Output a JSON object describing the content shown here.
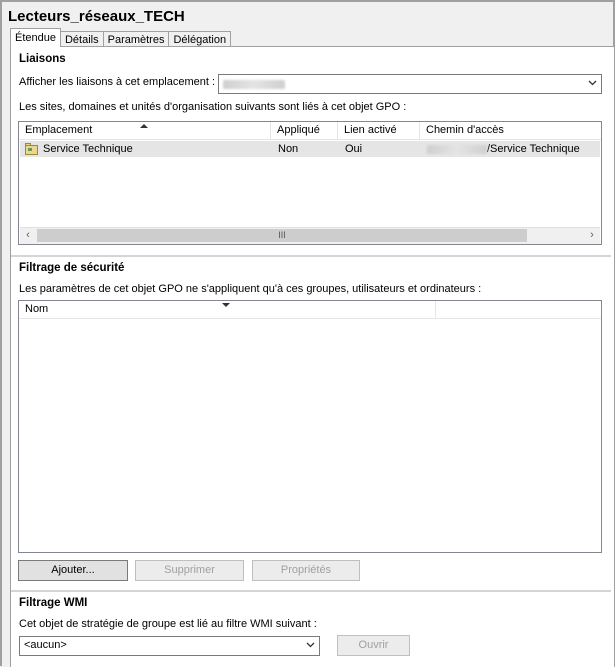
{
  "window": {
    "title": "Lecteurs_réseaux_TECH"
  },
  "tabs": [
    {
      "label": "Étendue",
      "active": true
    },
    {
      "label": "Détails",
      "active": false
    },
    {
      "label": "Paramètres",
      "active": false
    },
    {
      "label": "Délégation",
      "active": false
    }
  ],
  "links": {
    "heading": "Liaisons",
    "location_label": "Afficher les liaisons à cet emplacement :",
    "location_value_redacted": true,
    "description": "Les sites, domaines et unités d'organisation suivants sont liés à cet objet GPO :",
    "columns": [
      "Emplacement",
      "Appliqué",
      "Lien activé",
      "Chemin d'accès"
    ],
    "rows": [
      {
        "location": "Service Technique",
        "applied": "Non",
        "enabled": "Oui",
        "path": "/Service Technique"
      }
    ],
    "scroll_grip": "III"
  },
  "security": {
    "heading": "Filtrage de sécurité",
    "description": "Les paramètres de cet objet GPO ne s'appliquent qu'à ces groupes, utilisateurs et ordinateurs :",
    "columns": [
      "Nom"
    ],
    "buttons": {
      "add": "Ajouter...",
      "remove": "Supprimer",
      "properties": "Propriétés"
    }
  },
  "wmi": {
    "heading": "Filtrage WMI",
    "description": "Cet objet de stratégie de groupe est lié au filtre WMI suivant :",
    "selected": "<aucun>",
    "open_button": "Ouvrir"
  },
  "colors": {
    "selected_row": "#e5e5e5",
    "border": "#a0a0a0",
    "disabled_text": "#a0a0a0"
  }
}
